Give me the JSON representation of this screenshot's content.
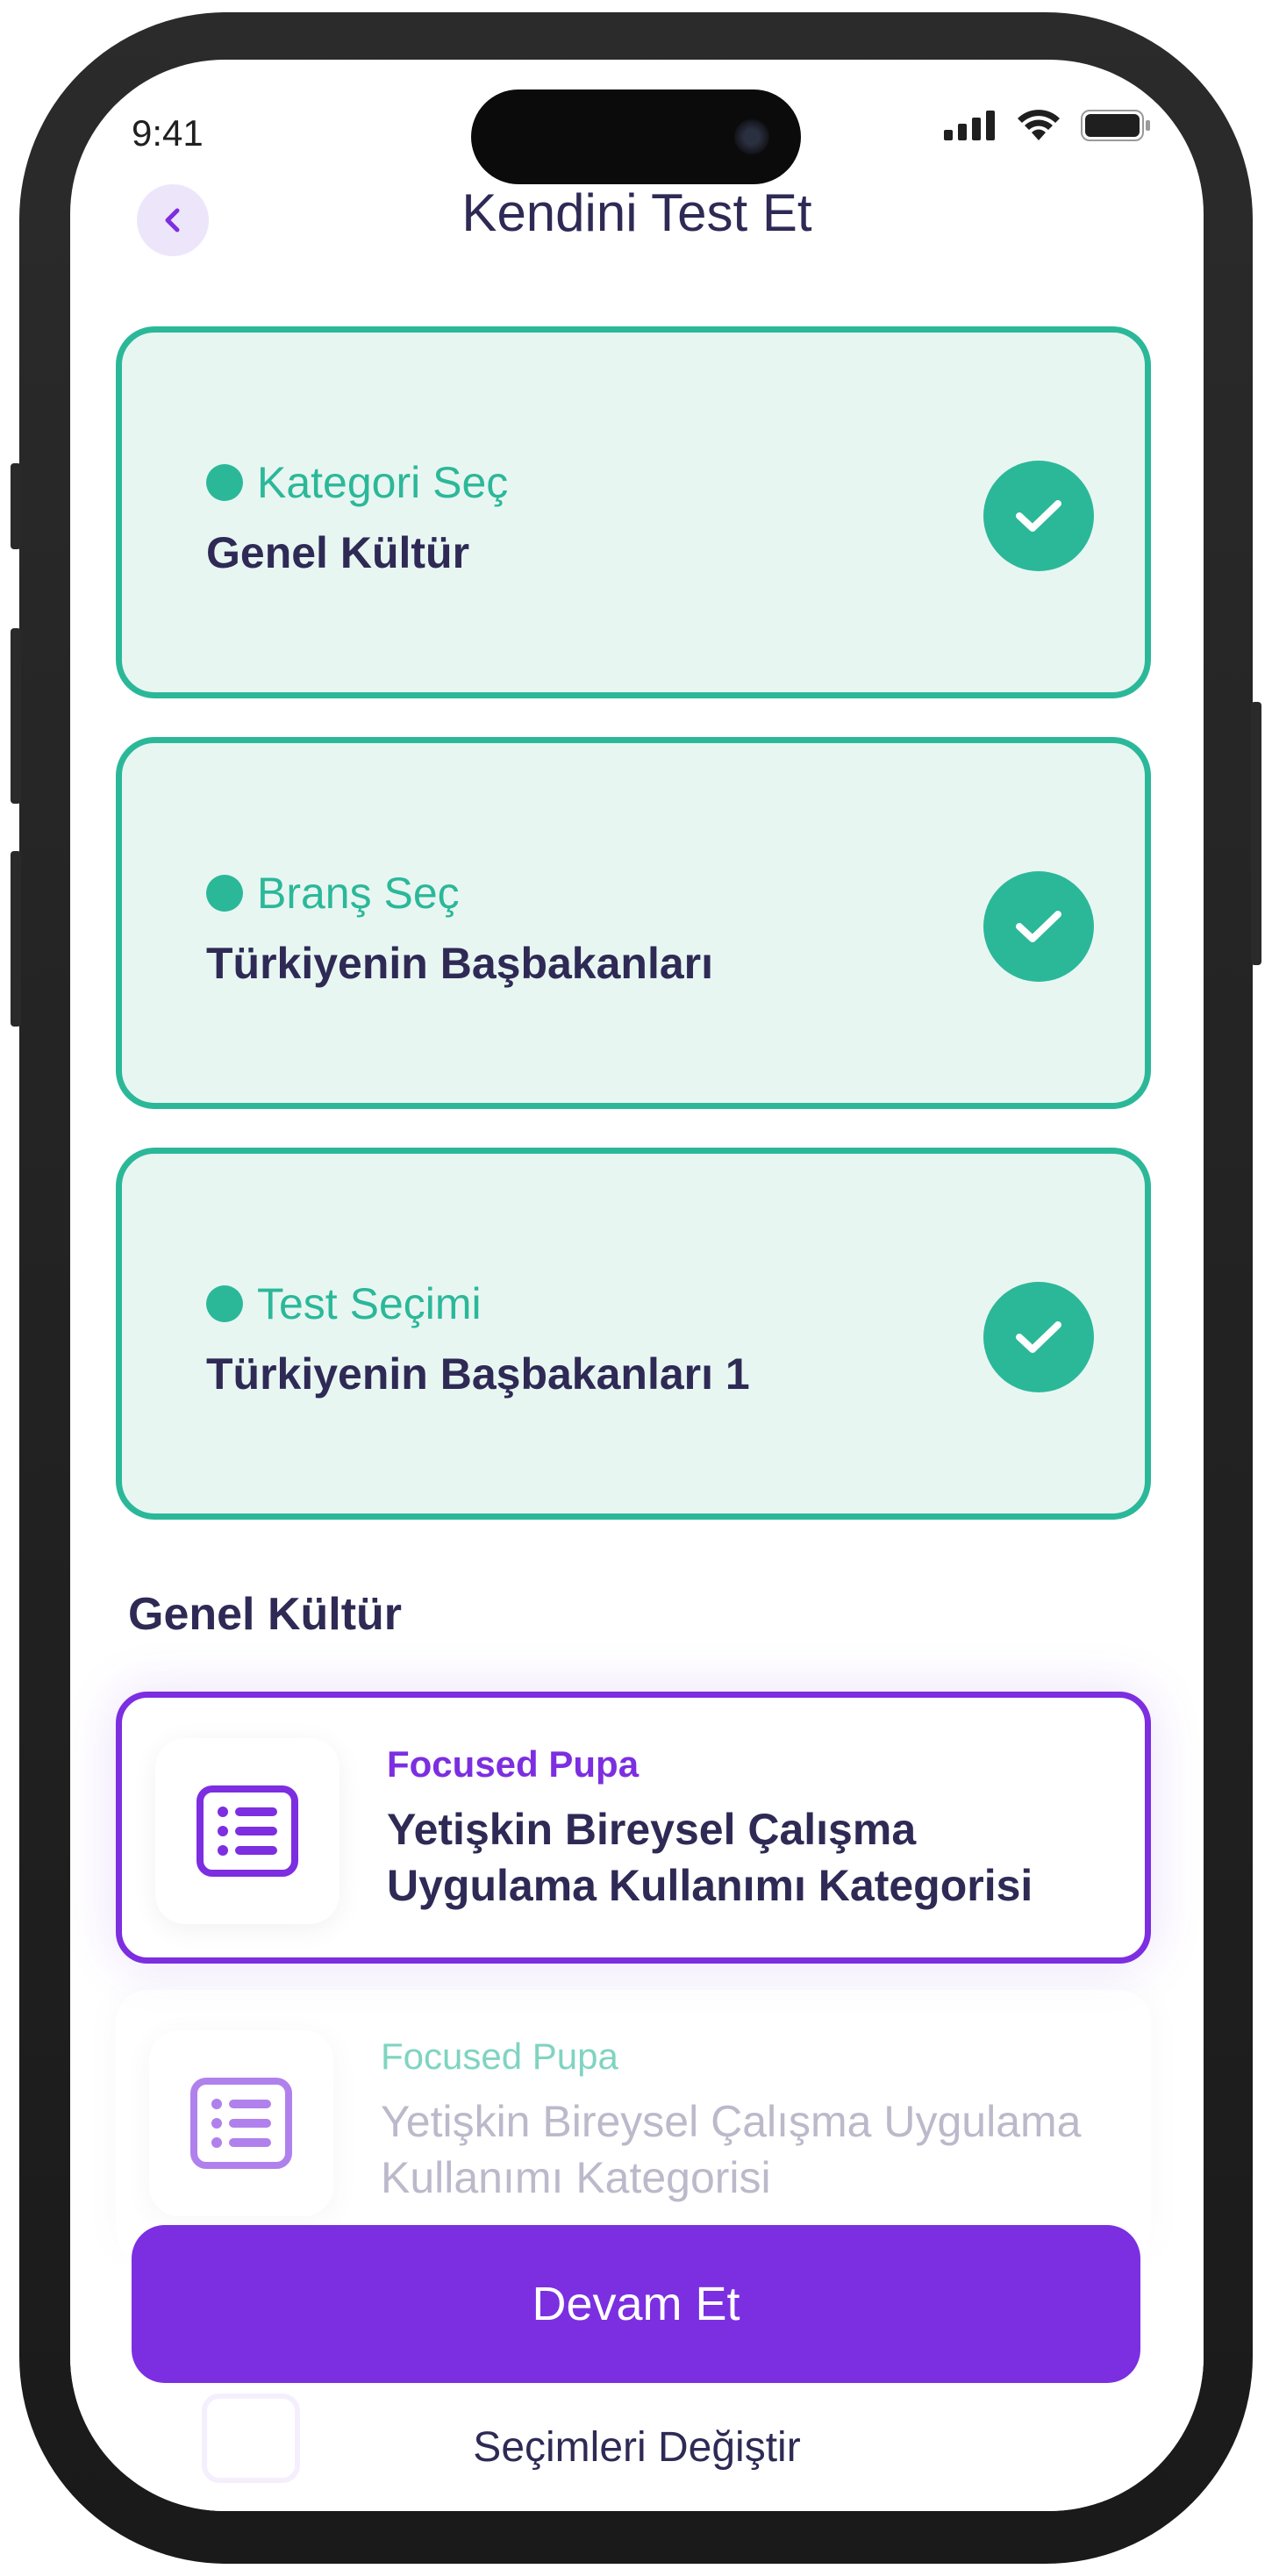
{
  "status": {
    "time": "9:41"
  },
  "header": {
    "title": "Kendini Test Et"
  },
  "steps": [
    {
      "label": "Kategori Seç",
      "value": "Genel Kültür"
    },
    {
      "label": "Branş Seç",
      "value": "Türkiyenin Başbakanları"
    },
    {
      "label": "Test Seçimi",
      "value": "Türkiyenin Başbakanları 1"
    }
  ],
  "section": {
    "title": "Genel Kültür"
  },
  "items": [
    {
      "kicker": "Focused Pupa",
      "title": "Yetişkin Bireysel Çalışma Uygulama Kullanımı Kategorisi",
      "state": "selected"
    },
    {
      "kicker": "Focused Pupa",
      "title": "Yetişkin Bireysel Çalışma Uygulama Kullanımı Kategorisi",
      "state": "unselected"
    }
  ],
  "actions": {
    "primary_label": "Devam Et",
    "secondary_label": "Seçimleri Değiştir"
  },
  "colors": {
    "accent": "#7b2fe1",
    "success": "#2bb899",
    "text": "#2e2a55",
    "success_bg": "#e8f6f2"
  }
}
